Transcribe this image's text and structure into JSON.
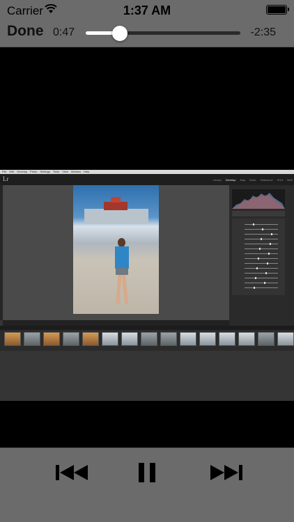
{
  "status_bar": {
    "carrier": "Carrier",
    "time": "1:37 AM",
    "battery_level": 1.0
  },
  "player": {
    "done_label": "Done",
    "elapsed": "0:47",
    "remaining": "-2:35",
    "progress": 0.22
  },
  "video_frame": {
    "app_menu": [
      "File",
      "Edit",
      "Develop",
      "Photo",
      "Settings",
      "Tools",
      "View",
      "Window",
      "Help"
    ],
    "modules": [
      "Library",
      "Develop",
      "Map",
      "Book",
      "Slideshow",
      "Print",
      "Web"
    ],
    "active_module": "Develop"
  },
  "controls": {
    "previous_icon": "skip-back-icon",
    "pause_icon": "pause-icon",
    "next_icon": "skip-forward-icon"
  }
}
